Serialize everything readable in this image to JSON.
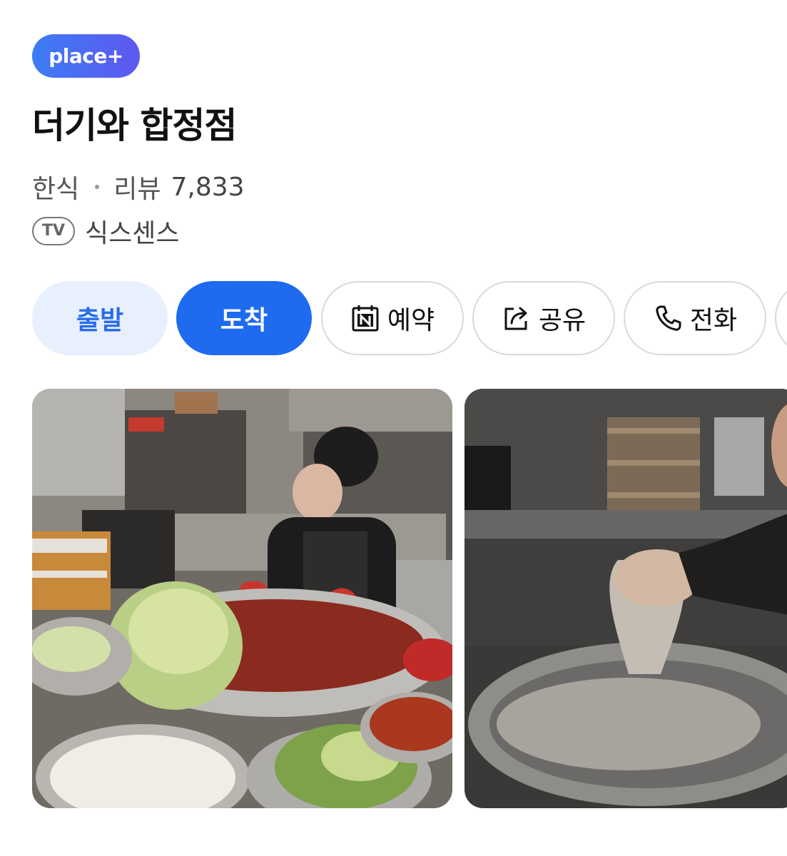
{
  "badge": {
    "label": "place+"
  },
  "place": {
    "name": "더기와 합정점",
    "category": "한식",
    "review_label": "리뷰",
    "review_count": "7,833",
    "tv_badge": "TV",
    "tv_show": "식스센스"
  },
  "actions": {
    "depart": "출발",
    "arrive": "도착",
    "reserve": "예약",
    "share": "공유",
    "call": "전화"
  },
  "icons": {
    "reserve": "naver-calendar-icon",
    "share": "share-icon",
    "call": "phone-icon"
  },
  "colors": {
    "badge_gradient_start": "#3d7cf4",
    "badge_gradient_end": "#5e58f0",
    "primary_blue": "#1e6bf0",
    "light_blue_bg": "#e8f0fd"
  }
}
